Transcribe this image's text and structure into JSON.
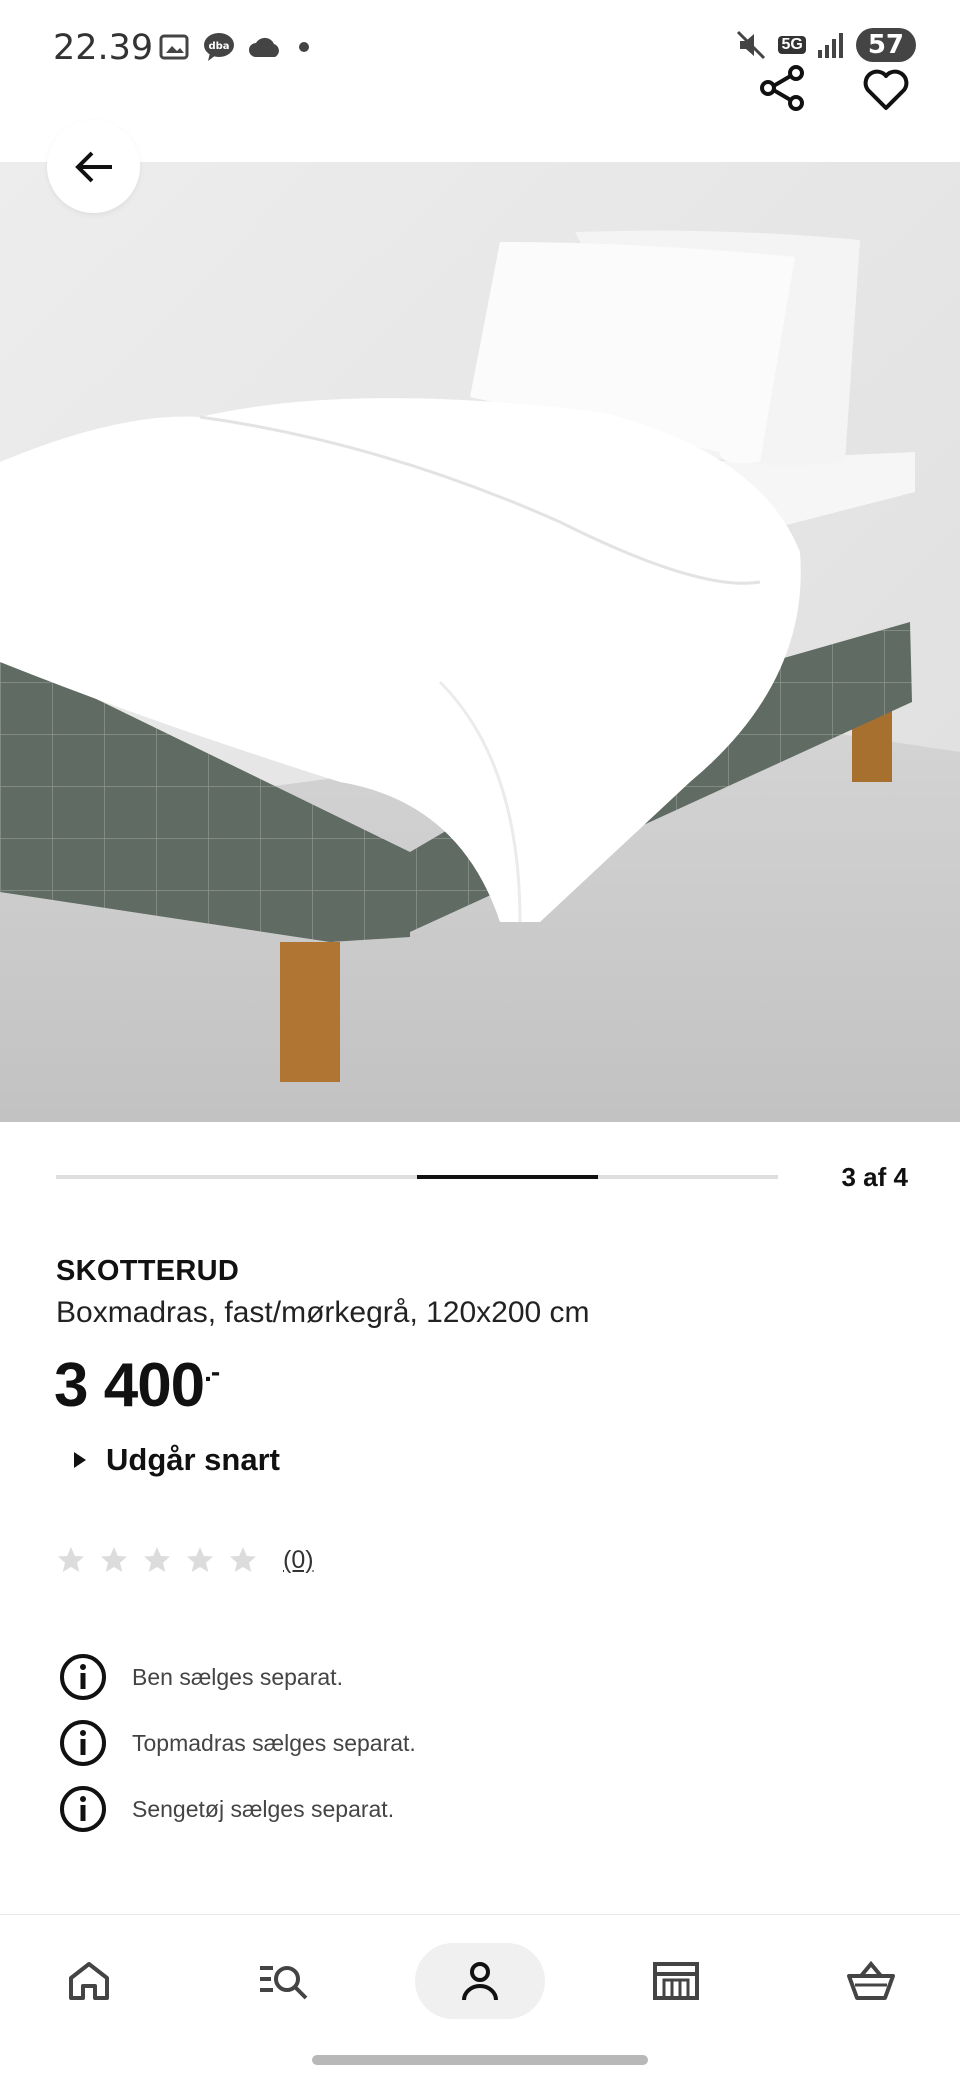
{
  "status_bar": {
    "time": "22.39",
    "network": "5G",
    "battery": "57",
    "icons_left": [
      "gallery-icon",
      "dba-chat-icon",
      "cloud-icon",
      "dot-icon"
    ],
    "icons_right": [
      "mute-icon",
      "network-5g-icon",
      "signal-icon",
      "battery-icon"
    ]
  },
  "top_actions": {
    "back_icon": "arrow-left-icon",
    "share_icon": "share-icon",
    "favorite_icon": "heart-icon"
  },
  "hero_image": {
    "description_icon": "bed-photo",
    "colors": {
      "wall": "#e9e9e9",
      "floor": "#c9c9c9",
      "fabric": "#5f6b63",
      "linen": "#ffffff",
      "leg": "#a8702e"
    }
  },
  "carousel": {
    "current": 3,
    "total": 4,
    "counter_label": "3 af 4"
  },
  "product": {
    "brand": "SKOTTERUD",
    "description": "Boxmadras, fast/mørkegrå, 120x200 cm",
    "price": "3 400",
    "price_suffix": ".-",
    "availability": "Udgår snart",
    "rating_stars": 0,
    "rating_max": 5,
    "rating_count": "(0)"
  },
  "notes": [
    {
      "icon": "info-icon",
      "text": "Ben sælges separat."
    },
    {
      "icon": "info-icon",
      "text": "Topmadras sælges separat."
    },
    {
      "icon": "info-icon",
      "text": "Sengetøj sælges separat."
    }
  ],
  "bottom_nav": {
    "items": [
      {
        "id": "home",
        "icon": "home-icon"
      },
      {
        "id": "search",
        "icon": "search-list-icon"
      },
      {
        "id": "profile",
        "icon": "person-icon",
        "active": true
      },
      {
        "id": "store",
        "icon": "store-icon"
      },
      {
        "id": "cart",
        "icon": "basket-icon"
      }
    ]
  },
  "colors": {
    "accent": "#111111",
    "track": "#dfdfdf",
    "star": "#dcdcdc"
  }
}
